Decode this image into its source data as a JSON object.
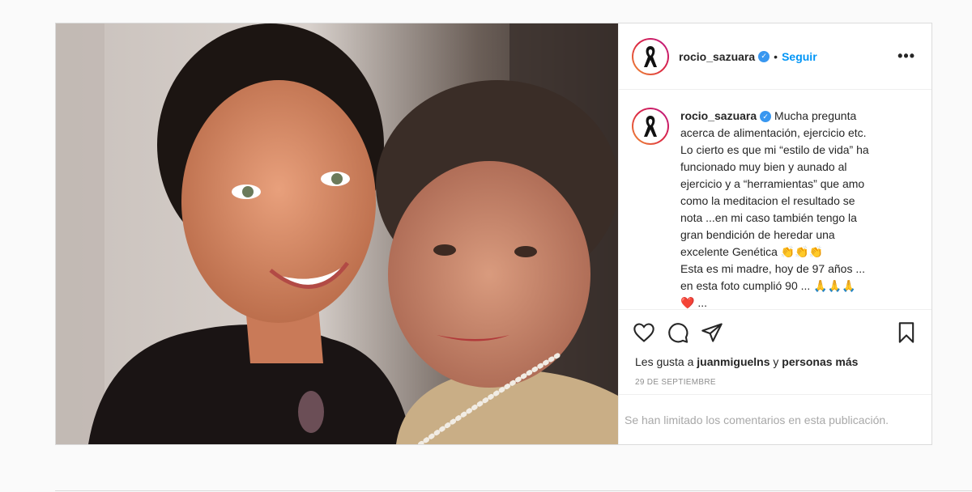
{
  "post": {
    "username": "rocio_sazuara",
    "verified_icon": "verified-badge-icon",
    "follow_label": "Seguir",
    "separator": "•",
    "more_label": "•••",
    "caption_user": "rocio_sazuara",
    "caption_lines": [
      " Mucha pregunta",
      "acerca de alimentación, ejercicio etc.",
      "Lo cierto es que mi “estilo de vida” ha",
      "funcionado muy bien y aunado al",
      "ejercicio y a “herramientas” que amo",
      "como la meditacion el resultado se",
      "nota ...en mi caso también tengo la",
      "gran bendición de heredar una",
      "excelente Genética 👏👏👏",
      "Esta es mi madre, hoy de 97 años ...",
      "en esta foto cumplió 90 ... 🙏🙏🙏",
      "❤️ ..."
    ],
    "likes_prefix": "Les gusta a ",
    "likes_user": "juanmiguelns",
    "likes_middle": " y ",
    "likes_suffix": "personas más",
    "date": "29 DE SEPTIEMBRE",
    "comments_limited": "Se han limitado los comentarios en esta publicación."
  },
  "colors": {
    "accent": "#0095f6",
    "verified": "#3897f0",
    "muted": "#8e8e8e"
  }
}
